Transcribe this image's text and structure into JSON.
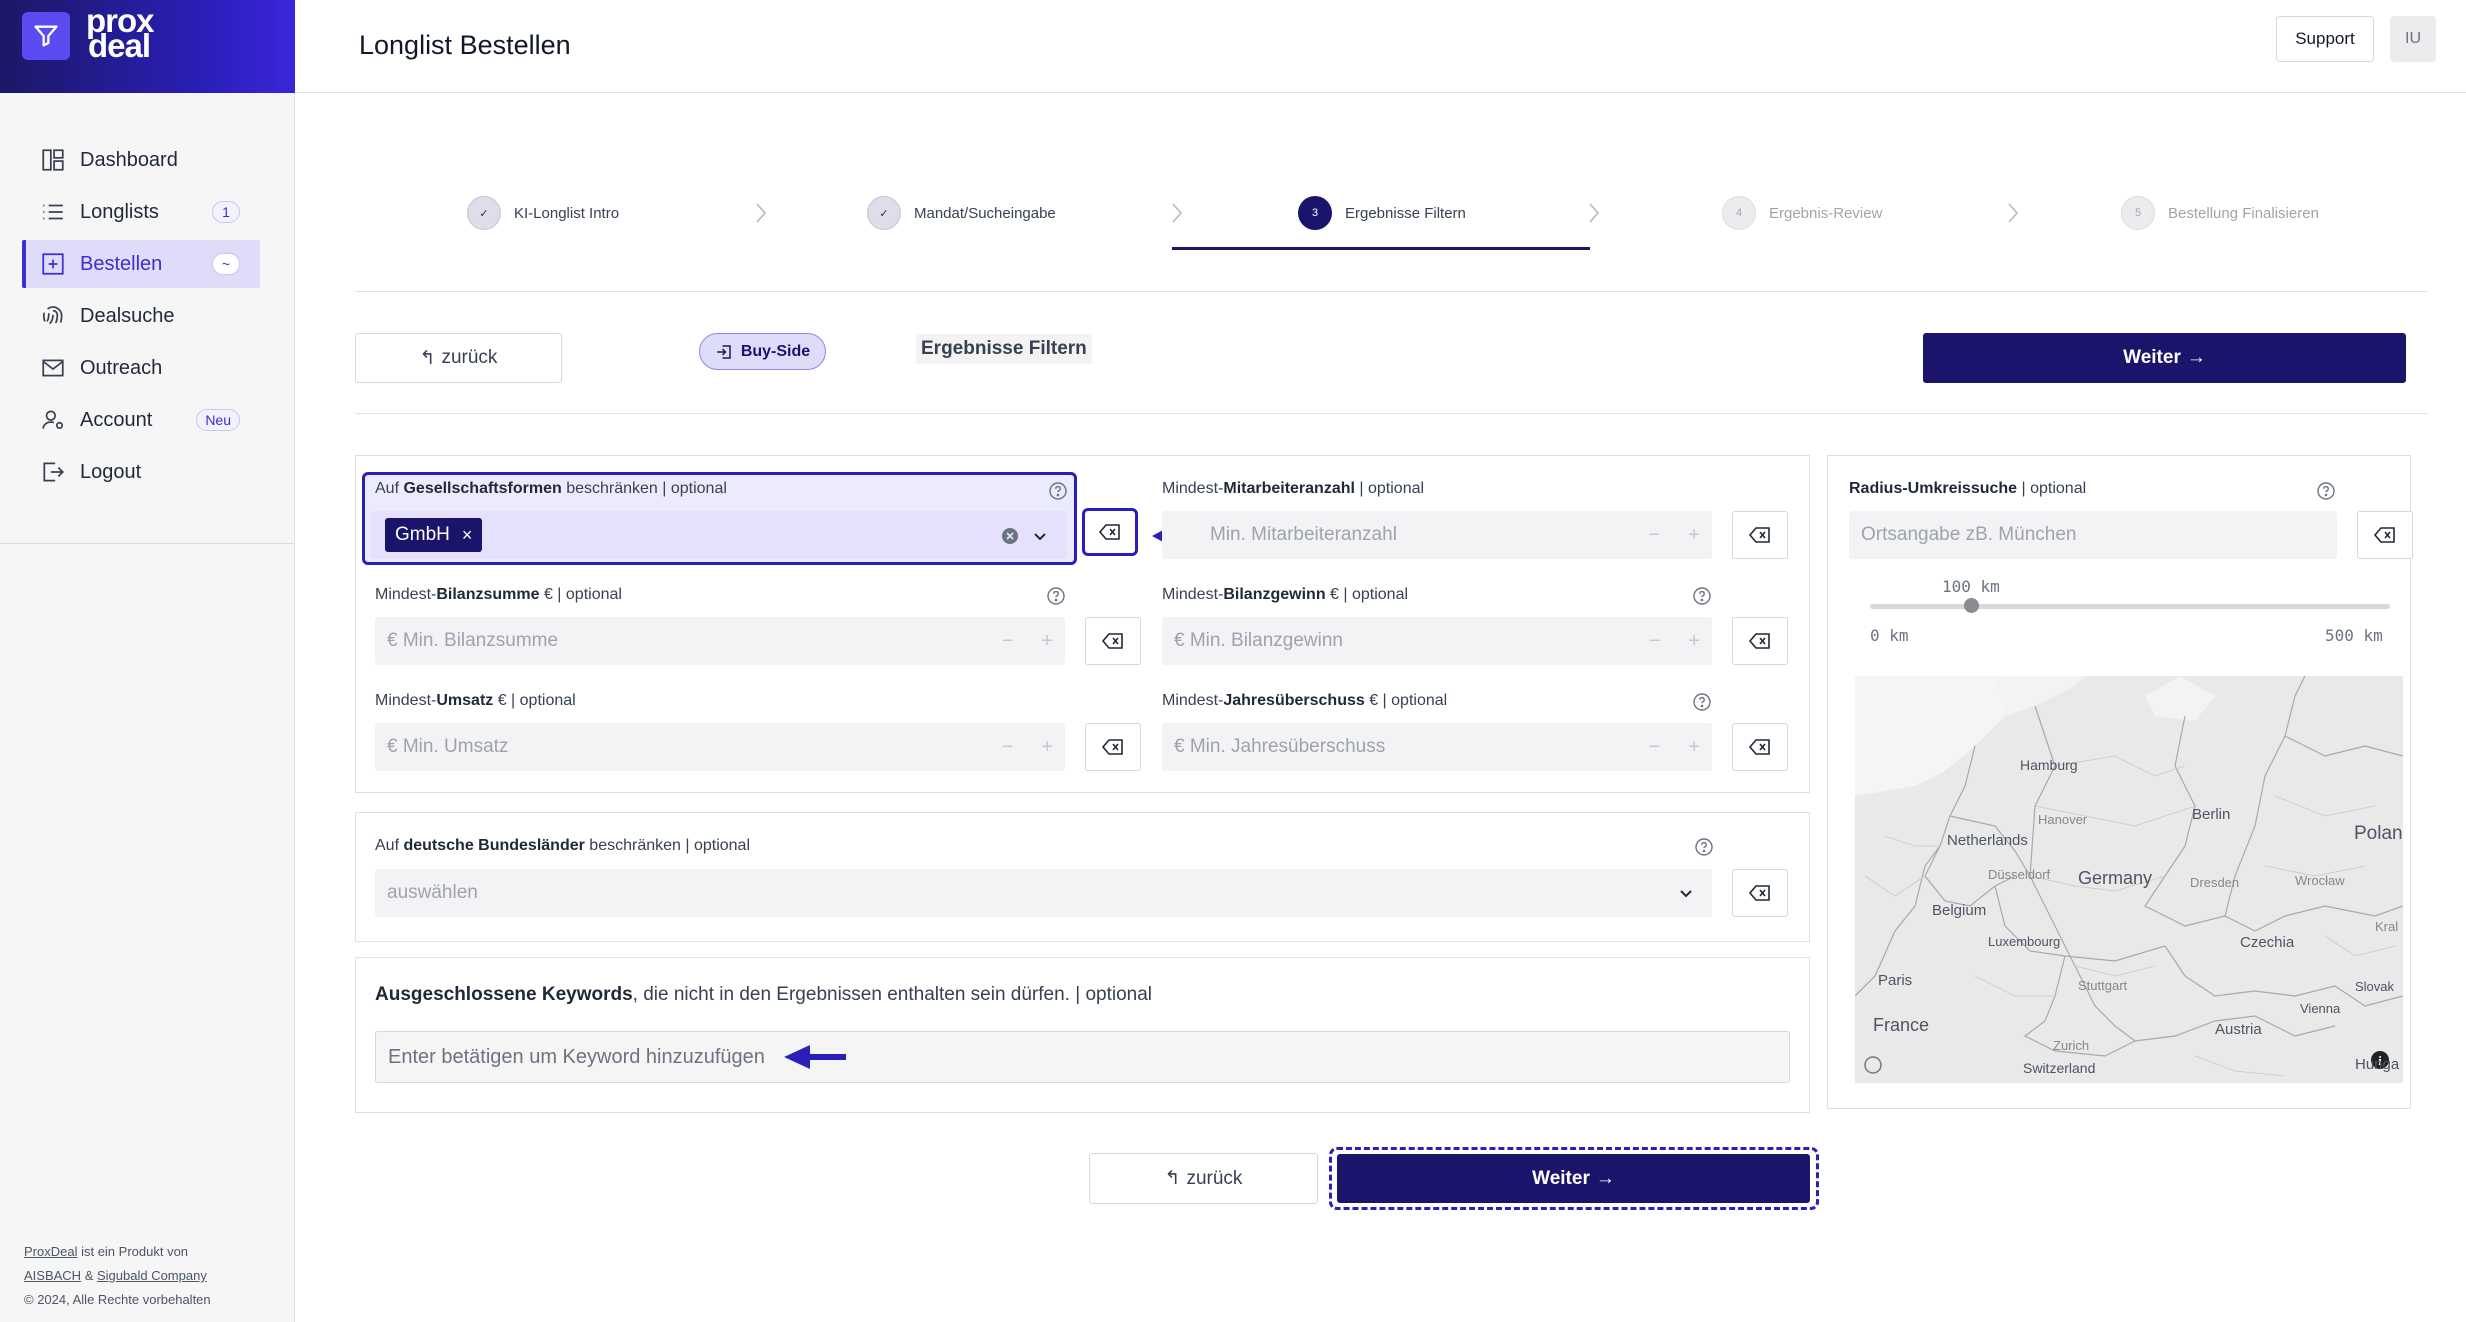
{
  "brand": {
    "line1": "prox",
    "line2": "deal"
  },
  "sidebar": {
    "items": [
      {
        "label": "Dashboard",
        "icon": "dashboard-icon"
      },
      {
        "label": "Longlists",
        "icon": "list-icon",
        "badge": "1"
      },
      {
        "label": "Bestellen",
        "icon": "plus-square-icon",
        "badge": "~",
        "active": true
      },
      {
        "label": "Dealsuche",
        "icon": "fingerprint-icon"
      },
      {
        "label": "Outreach",
        "icon": "mail-icon"
      },
      {
        "label": "Account",
        "icon": "user-settings-icon",
        "badge": "Neu"
      },
      {
        "label": "Logout",
        "icon": "logout-icon"
      }
    ],
    "footer": {
      "proxdeal_link": "ProxDeal",
      "line1_rest": " ist ein Produkt von",
      "aisbach_link": "AISBACH",
      "amp": " & ",
      "sigubald_link": "Sigubald Company",
      "copyright": "© 2024, Alle Rechte vorbehalten"
    }
  },
  "header": {
    "title": "Longlist Bestellen",
    "support_label": "Support",
    "user_initials": "IU"
  },
  "stepper": {
    "steps": [
      {
        "number": "✓",
        "label": "KI-Longlist Intro",
        "state": "done"
      },
      {
        "number": "✓",
        "label": "Mandat/Sucheingabe",
        "state": "done"
      },
      {
        "number": "3",
        "label": "Ergebnisse Filtern",
        "state": "current"
      },
      {
        "number": "4",
        "label": "Ergebnis-Review",
        "state": "todo"
      },
      {
        "number": "5",
        "label": "Bestellung Finalisieren",
        "state": "todo"
      }
    ]
  },
  "actions": {
    "back_label": "zurück",
    "buyside_label": "Buy-Side",
    "section_label": "Ergebnisse Filtern",
    "next_label": "Weiter"
  },
  "form": {
    "legal_form": {
      "label_pre": "Auf ",
      "label_bold": "Gesellschaftsformen",
      "label_post": " beschränken | optional",
      "tag": "GmbH"
    },
    "employees": {
      "label_pre": "Mindest-",
      "label_bold": "Mitarbeiteranzahl",
      "label_post": " | optional",
      "placeholder": "Min. Mitarbeiteranzahl"
    },
    "balance_sum": {
      "label_pre": "Mindest-",
      "label_bold": "Bilanzsumme",
      "label_post": " € | optional",
      "placeholder": "€ Min. Bilanzsumme"
    },
    "balance_profit": {
      "label_pre": "Mindest-",
      "label_bold": "Bilanzgewinn",
      "label_post": " € | optional",
      "placeholder": "€ Min. Bilanzgewinn"
    },
    "revenue": {
      "label_pre": "Mindest-",
      "label_bold": "Umsatz",
      "label_post": " € | optional",
      "placeholder": "€ Min. Umsatz"
    },
    "annual_surplus": {
      "label_pre": "Mindest-",
      "label_bold": "Jahresüberschuss",
      "label_post": " € | optional",
      "placeholder": "€ Min. Jahresüberschuss"
    },
    "states": {
      "label_pre": "Auf ",
      "label_bold": "deutsche Bundesländer",
      "label_post": " beschränken | optional",
      "placeholder": "auswählen"
    },
    "keywords": {
      "label_bold": "Ausgeschlossene Keywords",
      "label_post": ", die nicht in den Ergebnissen enthalten sein dürfen. | optional",
      "placeholder": "Enter betätigen um Keyword hinzuzufügen"
    },
    "radius": {
      "label_bold": "Radius-Umkreissuche",
      "label_post": " | optional",
      "placeholder": "Ortsangabe zB. München",
      "value_label": "100 km",
      "value_km": 100,
      "min_label": "0 km",
      "max_label": "500 km"
    }
  },
  "map": {
    "labels": [
      "Hamburg",
      "Hanover",
      "Berlin",
      "Netherlands",
      "Polan",
      "Düsseldorf",
      "Germany",
      "Dresden",
      "Wrocław",
      "Belgium",
      "Kral",
      "Luxembourg",
      "Czechia",
      "Paris",
      "Stuttgart",
      "Slovak",
      "Vienna",
      "France",
      "Austria",
      "Zurich",
      "Switzerland",
      "Hunga"
    ]
  },
  "bottom": {
    "back_label": "zurück",
    "next_label": "Weiter"
  },
  "colors": {
    "brand_dark": "#1a156b",
    "accent": "#2a1fb8",
    "active_bg": "#dedcf8"
  }
}
